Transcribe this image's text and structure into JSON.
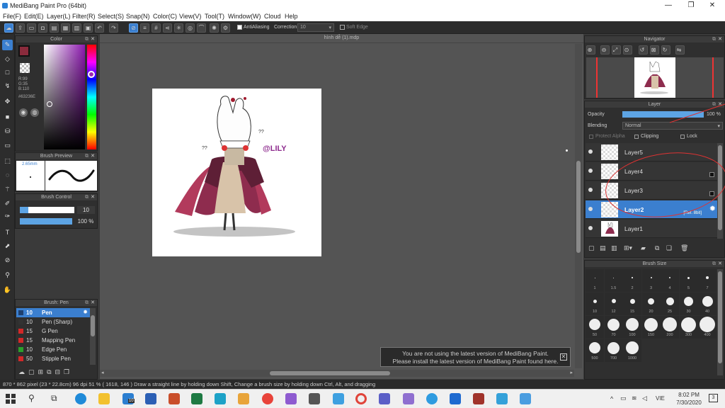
{
  "window": {
    "title": "MediBang Paint Pro (64bit)"
  },
  "menu": [
    "File(F)",
    "Edit(E)",
    "Layer(L)",
    "Filter(R)",
    "Select(S)",
    "Snap(N)",
    "Color(C)",
    "View(V)",
    "Tool(T)",
    "Window(W)",
    "Cloud",
    "Help"
  ],
  "toolbar": {
    "antialias_label": "AntiAliasing",
    "correction_label": "Correction",
    "correction_value": "10",
    "soft_edge_label": "Soft Edge"
  },
  "color_panel": {
    "title": "Color",
    "r": "R:99",
    "g": "G:35",
    "b": "B:110",
    "hex": "#63236E",
    "fg": "#8a2b3c",
    "bg": "#ffffff"
  },
  "brush_preview": {
    "title": "Brush Preview",
    "size": "2.65mm"
  },
  "brush_control": {
    "title": "Brush Control",
    "size_value": "10",
    "opacity_value": "100 %"
  },
  "brush_list": {
    "title": "Brush: Pen",
    "items": [
      {
        "size": "10",
        "name": "Pen",
        "color": "#1e3f6e"
      },
      {
        "size": "10",
        "name": "Pen (Sharp)",
        "color": "#333333"
      },
      {
        "size": "15",
        "name": "G Pen",
        "color": "#d22828"
      },
      {
        "size": "15",
        "name": "Mapping Pen",
        "color": "#d22828"
      },
      {
        "size": "10",
        "name": "Edge Pen",
        "color": "#2aa02a"
      },
      {
        "size": "50",
        "name": "Stipple Pen",
        "color": "#d22828"
      }
    ]
  },
  "canvas": {
    "title": "hình dễ (1).mdp"
  },
  "watermark": "@LILY",
  "notification": {
    "line1": "You are not using the latest version of MediBang Paint.",
    "line2": "Please install the latest version of MediBang Paint found here."
  },
  "status": {
    "text": "870 * 862 pixel  (23 * 22.8cm)  96 dpi  51 %  ( 1618, 146 )  Draw a straight line by holding down Shift, Change a brush size by holding down Ctrl, Alt, and dragging"
  },
  "navigator": {
    "title": "Navigator"
  },
  "layer_panel": {
    "title": "Layer",
    "opacity_label": "Opacity",
    "opacity_value": "100 %",
    "blending_label": "Blending",
    "blending_value": "Normal",
    "protect_alpha_label": "Protect Alpha",
    "clipping_label": "Clipping",
    "lock_label": "Lock",
    "selected_tag": "[Ref. 8bit]",
    "layers": [
      {
        "name": "Layer5"
      },
      {
        "name": "Layer4"
      },
      {
        "name": "Layer3"
      },
      {
        "name": "Layer2"
      },
      {
        "name": "Layer1"
      }
    ]
  },
  "brush_size_panel": {
    "title": "Brush Size",
    "sizes": [
      "1",
      "1.5",
      "2",
      "3",
      "4",
      "5",
      "7",
      "10",
      "12",
      "15",
      "20",
      "25",
      "30",
      "40",
      "50",
      "70",
      "100",
      "150",
      "200",
      "300",
      "400",
      "500",
      "700",
      "1000"
    ]
  },
  "taskbar": {
    "time": "8:02 PM",
    "date": "7/30/2020",
    "lang": "VIE",
    "notif_count": "3",
    "mail_badge": "10"
  }
}
